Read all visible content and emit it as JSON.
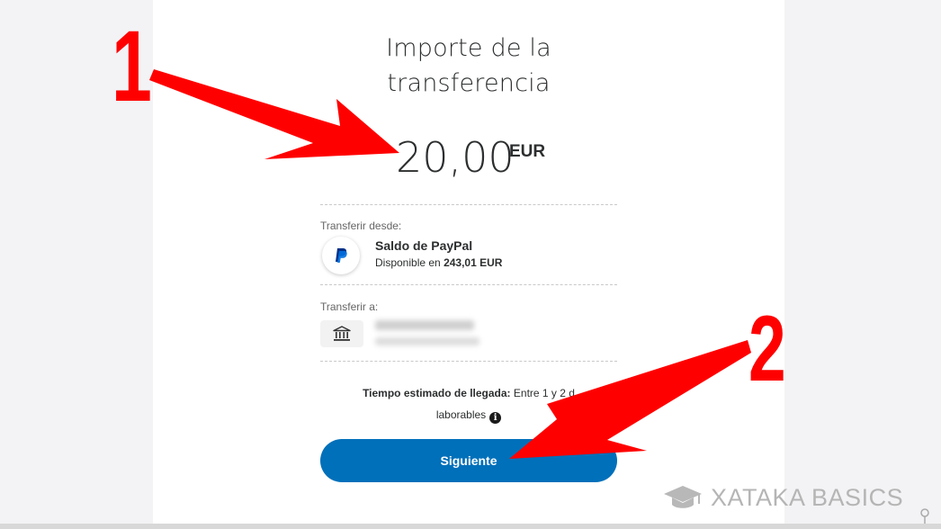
{
  "transfer": {
    "title_line1": "Importe de la",
    "title_line2": "transferencia",
    "amount": "20,00",
    "currency": "EUR"
  },
  "source": {
    "label": "Transferir desde:",
    "name": "Saldo de PayPal",
    "available_prefix": "Disponible en",
    "available_amount": "243,01 EUR"
  },
  "destination": {
    "label": "Transferir a:"
  },
  "eta": {
    "label": "Tiempo estimado de llegada:",
    "text_line1": "Entre 1 y 2 d",
    "text_line2": "laborables"
  },
  "buttons": {
    "next": "Siguiente"
  },
  "annotations": {
    "number1": "1",
    "number2": "2",
    "color": "#ff0000"
  },
  "branding": {
    "text": "XATAKA BASICS"
  },
  "colors": {
    "primary_button": "#0070ba",
    "page_background": "#f3f3f5"
  },
  "icons": {
    "paypal": "paypal-logo-icon",
    "bank": "bank-icon",
    "info": "info-icon",
    "brand": "graduation-cap-icon"
  }
}
